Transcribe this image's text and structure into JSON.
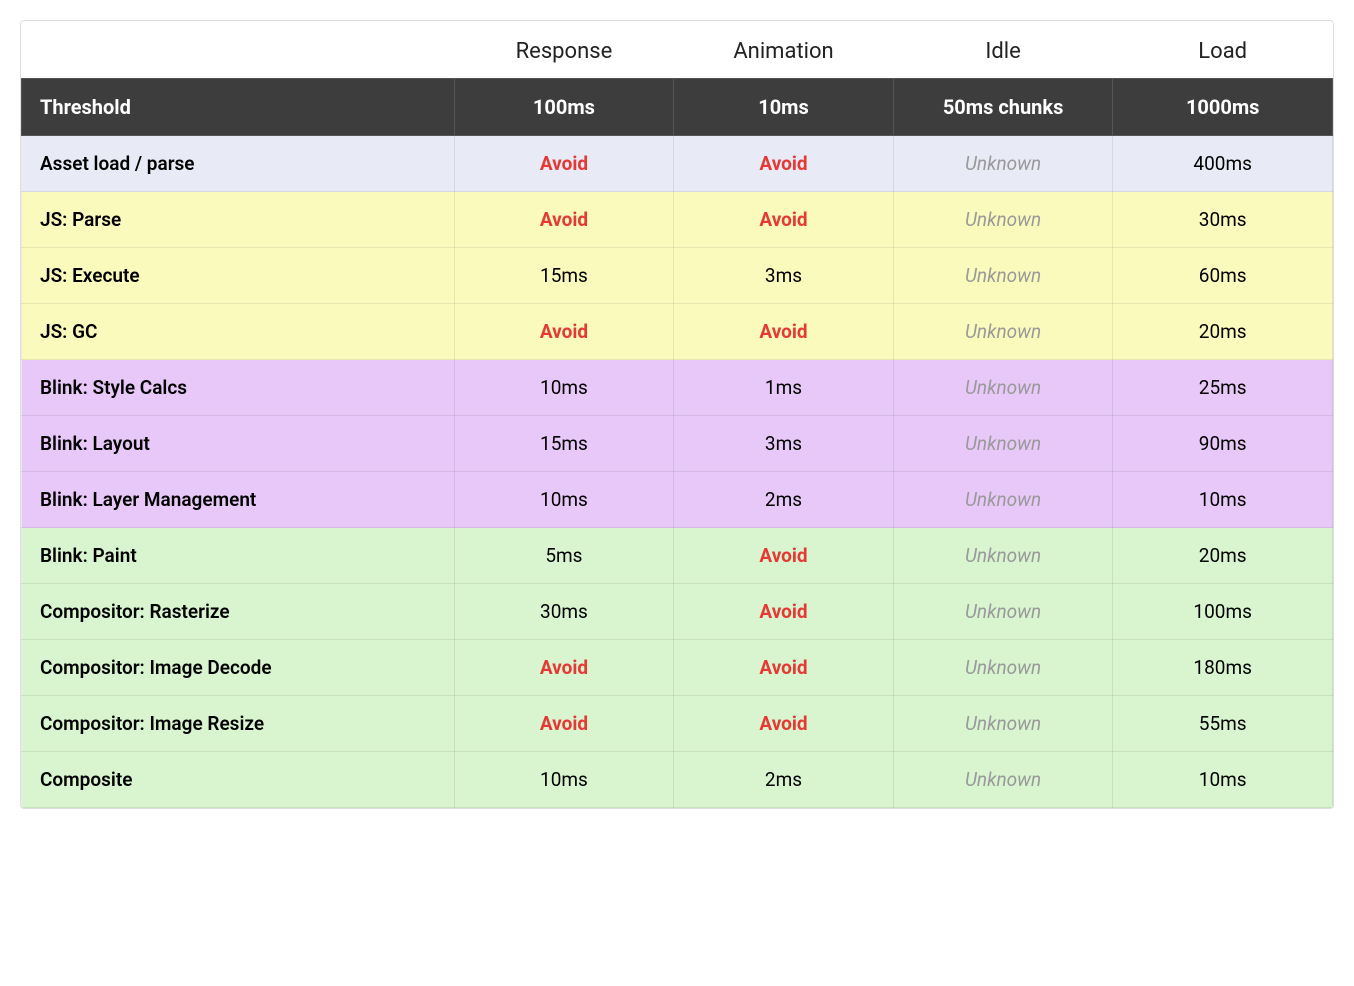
{
  "header": {
    "col1": "",
    "col2": "Response",
    "col3": "Animation",
    "col4": "Idle",
    "col5": "Load"
  },
  "threshold_row": {
    "label": "Threshold",
    "response": "100ms",
    "animation": "10ms",
    "idle": "50ms chunks",
    "load": "1000ms"
  },
  "rows": [
    {
      "group": "blue",
      "label": "Asset load / parse",
      "response": "Avoid",
      "response_type": "avoid",
      "animation": "Avoid",
      "animation_type": "avoid",
      "idle": "Unknown",
      "idle_type": "unknown",
      "load": "400ms",
      "load_type": "normal"
    },
    {
      "group": "yellow",
      "label": "JS: Parse",
      "response": "Avoid",
      "response_type": "avoid",
      "animation": "Avoid",
      "animation_type": "avoid",
      "idle": "Unknown",
      "idle_type": "unknown",
      "load": "30ms",
      "load_type": "normal"
    },
    {
      "group": "yellow",
      "label": "JS: Execute",
      "response": "15ms",
      "response_type": "normal",
      "animation": "3ms",
      "animation_type": "normal",
      "idle": "Unknown",
      "idle_type": "unknown",
      "load": "60ms",
      "load_type": "normal"
    },
    {
      "group": "yellow",
      "label": "JS: GC",
      "response": "Avoid",
      "response_type": "avoid",
      "animation": "Avoid",
      "animation_type": "avoid",
      "idle": "Unknown",
      "idle_type": "unknown",
      "load": "20ms",
      "load_type": "normal"
    },
    {
      "group": "purple",
      "label": "Blink: Style Calcs",
      "response": "10ms",
      "response_type": "normal",
      "animation": "1ms",
      "animation_type": "normal",
      "idle": "Unknown",
      "idle_type": "unknown",
      "load": "25ms",
      "load_type": "normal"
    },
    {
      "group": "purple",
      "label": "Blink: Layout",
      "response": "15ms",
      "response_type": "normal",
      "animation": "3ms",
      "animation_type": "normal",
      "idle": "Unknown",
      "idle_type": "unknown",
      "load": "90ms",
      "load_type": "normal"
    },
    {
      "group": "purple",
      "label": "Blink: Layer Management",
      "response": "10ms",
      "response_type": "normal",
      "animation": "2ms",
      "animation_type": "normal",
      "idle": "Unknown",
      "idle_type": "unknown",
      "load": "10ms",
      "load_type": "normal"
    },
    {
      "group": "green",
      "label": "Blink: Paint",
      "response": "5ms",
      "response_type": "normal",
      "animation": "Avoid",
      "animation_type": "avoid",
      "idle": "Unknown",
      "idle_type": "unknown",
      "load": "20ms",
      "load_type": "normal"
    },
    {
      "group": "green",
      "label": "Compositor: Rasterize",
      "response": "30ms",
      "response_type": "normal",
      "animation": "Avoid",
      "animation_type": "avoid",
      "idle": "Unknown",
      "idle_type": "unknown",
      "load": "100ms",
      "load_type": "normal"
    },
    {
      "group": "green",
      "label": "Compositor: Image Decode",
      "response": "Avoid",
      "response_type": "avoid",
      "animation": "Avoid",
      "animation_type": "avoid",
      "idle": "Unknown",
      "idle_type": "unknown",
      "load": "180ms",
      "load_type": "normal"
    },
    {
      "group": "green",
      "label": "Compositor: Image Resize",
      "response": "Avoid",
      "response_type": "avoid",
      "animation": "Avoid",
      "animation_type": "avoid",
      "idle": "Unknown",
      "idle_type": "unknown",
      "load": "55ms",
      "load_type": "normal"
    },
    {
      "group": "green",
      "label": "Composite",
      "response": "10ms",
      "response_type": "normal",
      "animation": "2ms",
      "animation_type": "normal",
      "idle": "Unknown",
      "idle_type": "unknown",
      "load": "10ms",
      "load_type": "normal"
    }
  ]
}
